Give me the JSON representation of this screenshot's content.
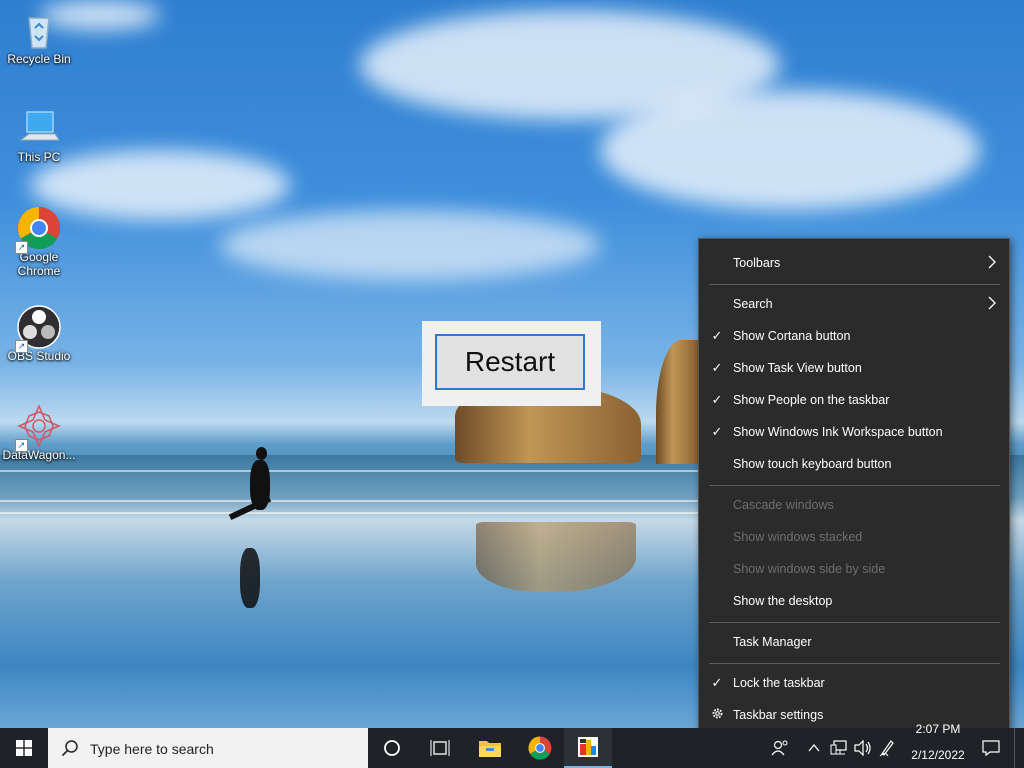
{
  "desktop": {
    "icons": [
      {
        "label": "Recycle Bin",
        "icon": "recycle-bin-icon"
      },
      {
        "label": "This PC",
        "icon": "computer-icon"
      },
      {
        "label": "Google Chrome",
        "icon": "chrome-icon"
      },
      {
        "label": "OBS Studio",
        "icon": "obs-icon"
      },
      {
        "label": "DataWagon...",
        "icon": "datawagon-icon"
      }
    ]
  },
  "dialog": {
    "restart_label": "Restart"
  },
  "context_menu": {
    "items": [
      {
        "label": "Toolbars",
        "checked": false,
        "submenu": true,
        "disabled": false
      },
      {
        "label": "Search",
        "checked": false,
        "submenu": true,
        "disabled": false
      },
      {
        "label": "Show Cortana button",
        "checked": true,
        "submenu": false,
        "disabled": false
      },
      {
        "label": "Show Task View button",
        "checked": true,
        "submenu": false,
        "disabled": false
      },
      {
        "label": "Show People on the taskbar",
        "checked": true,
        "submenu": false,
        "disabled": false
      },
      {
        "label": "Show Windows Ink Workspace button",
        "checked": true,
        "submenu": false,
        "disabled": false
      },
      {
        "label": "Show touch keyboard button",
        "checked": false,
        "submenu": false,
        "disabled": false
      },
      {
        "label": "Cascade windows",
        "checked": false,
        "submenu": false,
        "disabled": true
      },
      {
        "label": "Show windows stacked",
        "checked": false,
        "submenu": false,
        "disabled": true
      },
      {
        "label": "Show windows side by side",
        "checked": false,
        "submenu": false,
        "disabled": true
      },
      {
        "label": "Show the desktop",
        "checked": false,
        "submenu": false,
        "disabled": false
      },
      {
        "label": "Task Manager",
        "checked": false,
        "submenu": false,
        "disabled": false
      },
      {
        "label": "Lock the taskbar",
        "checked": true,
        "submenu": false,
        "disabled": false
      },
      {
        "label": "Taskbar settings",
        "checked": false,
        "submenu": false,
        "disabled": false,
        "icon": "gear-icon"
      }
    ]
  },
  "taskbar": {
    "search_placeholder": "Type here to search",
    "pinned": [
      "cortana-icon",
      "task-view-icon",
      "file-explorer-icon",
      "chrome-icon",
      "app-icon"
    ],
    "clock": {
      "time": "2:07 PM",
      "date": "2/12/2022"
    }
  },
  "colors": {
    "menu_bg": "#2b2b2b",
    "taskbar_bg": "#1f2328",
    "accent": "#2b79d0"
  }
}
